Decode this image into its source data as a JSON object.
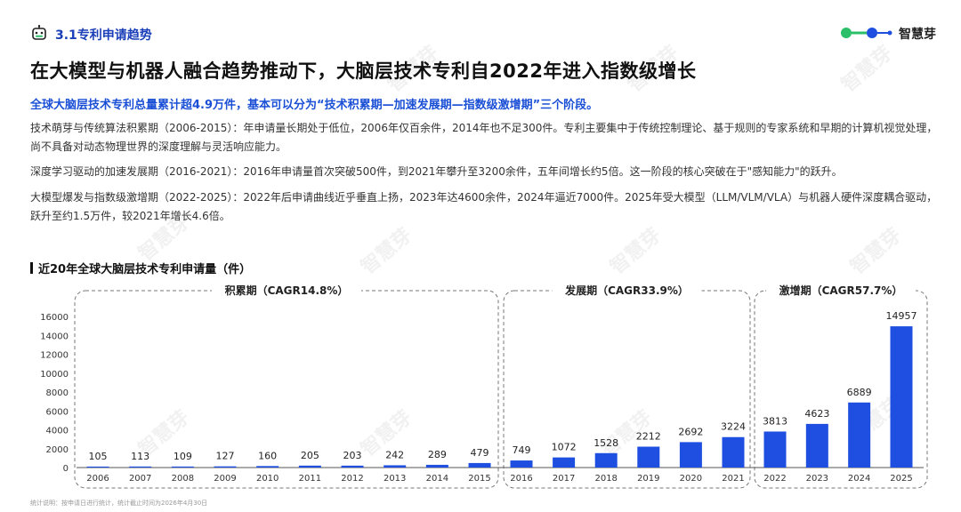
{
  "header": {
    "section_title": "3.1专利申请趋势",
    "brand_name": "智慧芽"
  },
  "headline": "在大模型与机器人融合趋势推动下，大脑层技术专利自2022年进入指数级增长",
  "summary": "全球大脑层技术专利总量累计超4.9万件，基本可以分为“技术积累期—加速发展期—指数级激增期”三个阶段。",
  "paragraphs": [
    "技术萌芽与传统算法积累期（2006-2015）：年申请量长期处于低位，2006年仅百余件，2014年也不足300件。专利主要集中于传统控制理论、基于规则的专家系统和早期的计算机视觉处理，尚不具备对动态物理世界的深度理解与灵活响应能力。",
    "深度学习驱动的加速发展期（2016-2021）：2016年申请量首次突破500件，到2021年攀升至3200余件，五年间增长约5倍。这一阶段的核心突破在于\"感知能力\"的跃升。",
    "大模型爆发与指数级激增期（2022-2025）：2022年后申请曲线近乎垂直上扬，2023年达4600余件，2024年逼近7000件。2025年受大模型（LLM/VLM/VLA）与机器人硬件深度耦合驱动，跃升至约1.5万件，较2021年增长4.6倍。"
  ],
  "chart_title": "近20年全球大脑层技术专利申请量（件）",
  "footnote": "统计说明：按申请日进行统计，统计截止时间为2026年4月30日",
  "watermark_text": "智慧芽",
  "colors": {
    "bar": "#1f4fe0",
    "accent": "#1a3fb8",
    "brand_green": "#2bbf6a"
  },
  "chart_data": {
    "type": "bar",
    "categories": [
      "2006",
      "2007",
      "2008",
      "2009",
      "2010",
      "2011",
      "2012",
      "2013",
      "2014",
      "2015",
      "2016",
      "2017",
      "2018",
      "2019",
      "2020",
      "2021",
      "2022",
      "2023",
      "2024",
      "2025"
    ],
    "values": [
      105,
      113,
      109,
      127,
      160,
      205,
      203,
      242,
      289,
      479,
      749,
      1072,
      1528,
      2212,
      2692,
      3224,
      3813,
      4623,
      6889,
      14957
    ],
    "ylim": [
      0,
      16000
    ],
    "yticks": [
      0,
      2000,
      4000,
      6000,
      8000,
      10000,
      12000,
      14000,
      16000
    ],
    "grid": false,
    "phases": [
      {
        "label": "积累期（CAGR14.8%）",
        "start": 0,
        "end": 9
      },
      {
        "label": "发展期（CAGR33.9%）",
        "start": 10,
        "end": 15
      },
      {
        "label": "激增期（CAGR57.7%）",
        "start": 16,
        "end": 19
      }
    ]
  }
}
